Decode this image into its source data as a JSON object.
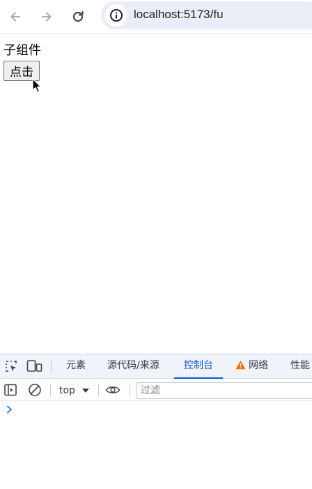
{
  "browser": {
    "url": "localhost:5173/fu"
  },
  "page": {
    "child_label": "子组件",
    "button_label": "点击"
  },
  "devtools": {
    "tabs": [
      {
        "label": "元素"
      },
      {
        "label": "源代码/来源"
      },
      {
        "label": "控制台",
        "active": true
      },
      {
        "label": "网络",
        "warning": true
      },
      {
        "label": "性能"
      }
    ],
    "context": "top",
    "filter_placeholder": "过滤",
    "colors": {
      "accent": "#0b57d0",
      "warning": "#e8710a"
    }
  }
}
